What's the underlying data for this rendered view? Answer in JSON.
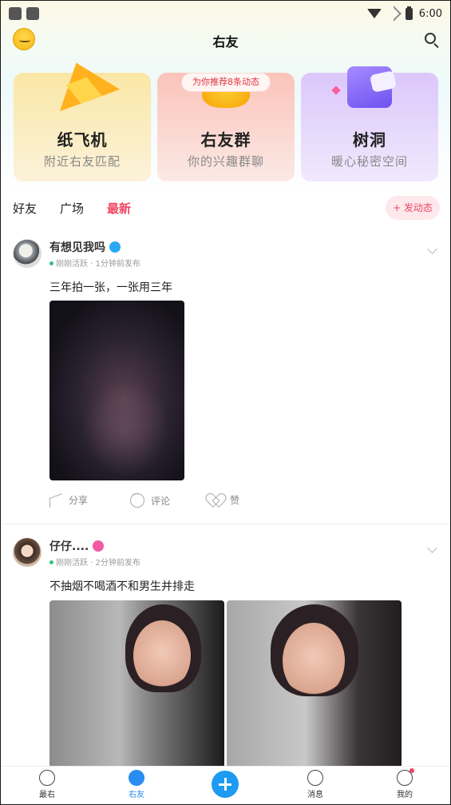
{
  "status_bar": {
    "time": "6:00"
  },
  "header": {
    "title": "右友"
  },
  "feature_cards": [
    {
      "title": "纸飞机",
      "subtitle": "附近右友匹配"
    },
    {
      "title": "右友群",
      "subtitle": "你的兴趣群聊",
      "badge": "为你推荐8条动态"
    },
    {
      "title": "树洞",
      "subtitle": "暖心秘密空间"
    }
  ],
  "tabs": [
    {
      "label": "好友"
    },
    {
      "label": "广场"
    },
    {
      "label": "最新",
      "active": true
    }
  ],
  "post_button": "+ 发动态",
  "posts": [
    {
      "author": "有想见我吗",
      "gender": "male",
      "status": "刚刚活跃",
      "time": "1分钟前发布",
      "text": "三年拍一张，一张用三年",
      "actions": {
        "share": "分享",
        "comment": "评论",
        "like": "赞"
      }
    },
    {
      "author": "仔仔....",
      "gender": "female",
      "status": "刚刚活跃",
      "time": "2分钟前发布",
      "text": "不抽烟不喝酒不和男生并排走"
    }
  ],
  "bottom_nav": [
    {
      "label": "最右",
      "icon": "face-icon"
    },
    {
      "label": "右友",
      "icon": "planet-icon",
      "active": true
    },
    {
      "label": "",
      "icon": "plus-icon"
    },
    {
      "label": "消息",
      "icon": "message-icon"
    },
    {
      "label": "我的",
      "icon": "profile-icon",
      "has_dot": true
    }
  ],
  "colors": {
    "accent_red": "#f04461",
    "accent_blue": "#2a8cf0"
  }
}
